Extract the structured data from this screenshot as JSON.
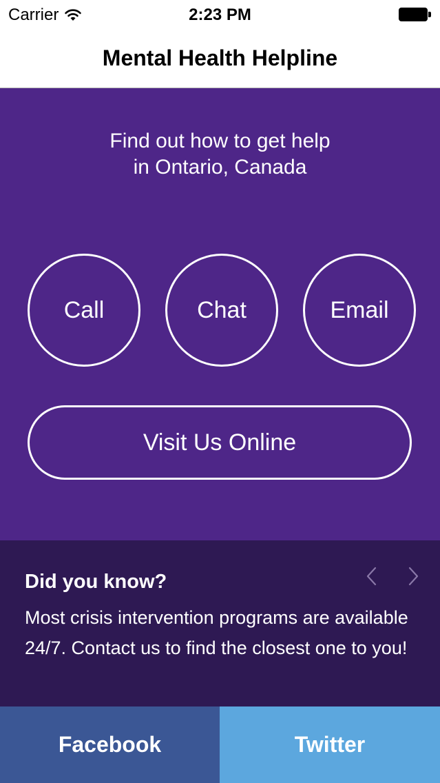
{
  "status_bar": {
    "carrier": "Carrier",
    "time": "2:23 PM"
  },
  "nav": {
    "title": "Mental Health Helpline"
  },
  "main": {
    "intro_line1": "Find out how to get help",
    "intro_line2": "in Ontario, Canada",
    "buttons": {
      "call": "Call",
      "chat": "Chat",
      "email": "Email",
      "visit": "Visit Us Online"
    }
  },
  "tips": {
    "heading": "Did you know?",
    "body": "Most crisis intervention programs are available 24/7. Contact us to find the closest one to you!"
  },
  "social": {
    "facebook": "Facebook",
    "twitter": "Twitter"
  },
  "colors": {
    "primary_purple": "#4e2688",
    "dark_purple": "#2e1953",
    "facebook_blue": "#3b5795",
    "twitter_blue": "#5ca7de"
  },
  "icons": [
    "wifi-icon",
    "battery-icon",
    "chevron-left-icon",
    "chevron-right-icon"
  ]
}
